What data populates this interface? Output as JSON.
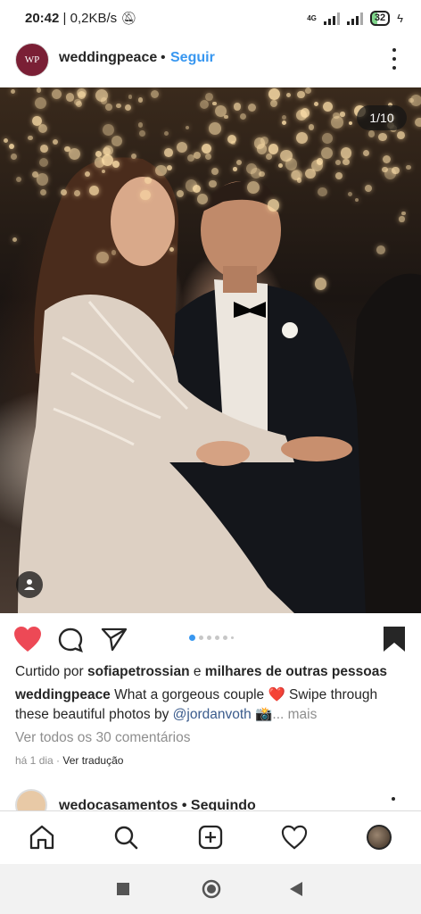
{
  "status_bar": {
    "time": "20:42",
    "speed": "0,2KB/s",
    "network": "4G",
    "battery": "32"
  },
  "post": {
    "avatar_text": "WP",
    "username": "weddingpeace",
    "separator": "•",
    "follow_label": "Seguir",
    "image_counter": "1/10",
    "carousel": {
      "total_dots": 6,
      "active_index": 0
    },
    "liked": true,
    "likes": {
      "prefix": "Curtido por ",
      "user": "sofiapetrossian",
      "middle": " e ",
      "others": "milhares de outras pessoas"
    },
    "caption": {
      "username": "weddingpeace",
      "text": " What a gorgeous couple ❤️ Swipe through these beautiful photos by ",
      "mention": "@jordanvoth",
      "emoji": " 📸",
      "more": "... mais"
    },
    "view_comments": "Ver todos os 30 comentários",
    "time_ago": "há 1 dia",
    "meta_separator": " · ",
    "translate": "Ver tradução"
  },
  "next_post": {
    "username": "wedocasamentos",
    "separator": " • ",
    "status": "Seguindo"
  },
  "colors": {
    "like_red": "#ed4956",
    "link_blue": "#3897f0",
    "mention_blue": "#3a5b8c",
    "muted": "#8e8e8e"
  },
  "icons": {
    "like": "heart-icon",
    "comment": "comment-icon",
    "share": "send-icon",
    "save": "bookmark-icon",
    "home": "home-icon",
    "search": "search-icon",
    "new_post": "add-post-icon",
    "activity": "activity-heart-icon",
    "profile": "profile-avatar-icon",
    "tag": "user-tag-icon",
    "recent": "square-icon",
    "home_sys": "circle-icon",
    "back": "back-triangle-icon"
  }
}
